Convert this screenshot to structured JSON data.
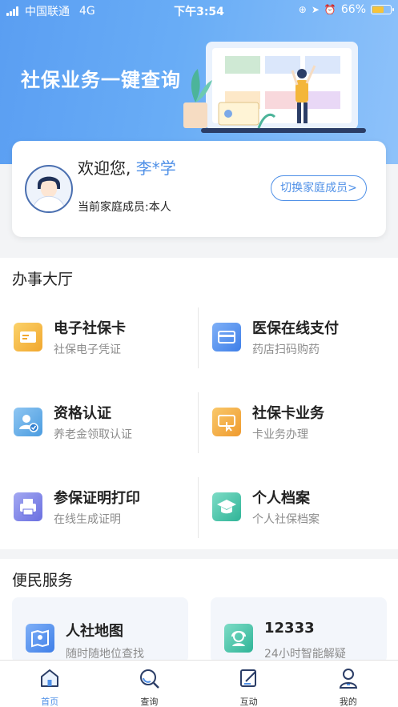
{
  "status_bar": {
    "carrier": "中国联通",
    "network": "4G",
    "time": "下午3:54",
    "battery": "66%"
  },
  "hero": {
    "title": "社保业务一键查询"
  },
  "user_card": {
    "greeting": "欢迎您,",
    "user_name": "李*学",
    "family_member": "当前家庭成员:本人",
    "switch_label": "切换家庭成员>"
  },
  "hall": {
    "title": "办事大厅",
    "items": [
      {
        "title": "电子社保卡",
        "subtitle": "社保电子凭证",
        "icon": "e-card-icon",
        "color": "#f4b63a"
      },
      {
        "title": "医保在线支付",
        "subtitle": "药店扫码购药",
        "icon": "payment-card-icon",
        "color": "#4f8ff0"
      },
      {
        "title": "资格认证",
        "subtitle": "养老金领取认证",
        "icon": "user-verify-icon",
        "color": "#5aa8e8"
      },
      {
        "title": "社保卡业务",
        "subtitle": "卡业务办理",
        "icon": "card-service-icon",
        "color": "#f3a63c"
      },
      {
        "title": "参保证明打印",
        "subtitle": "在线生成证明",
        "icon": "printer-icon",
        "color": "#7e83e8"
      },
      {
        "title": "个人档案",
        "subtitle": "个人社保档案",
        "icon": "graduation-cap-icon",
        "color": "#3fc3a8"
      }
    ]
  },
  "services": {
    "title": "便民服务",
    "items": [
      {
        "title": "人社地图",
        "subtitle": "随时随地位查找",
        "icon": "map-icon",
        "color": "#4f8ff0"
      },
      {
        "title": "12333",
        "subtitle": "24小时智能解疑",
        "icon": "customer-service-icon",
        "color": "#3fc3a8"
      }
    ]
  },
  "tabbar": {
    "tabs": [
      {
        "label": "首页",
        "icon": "home-icon",
        "active": true
      },
      {
        "label": "查询",
        "icon": "search-icon",
        "active": false
      },
      {
        "label": "互动",
        "icon": "edit-icon",
        "active": false
      },
      {
        "label": "我的",
        "icon": "profile-icon",
        "active": false
      }
    ],
    "active_color": "#4f90e7"
  }
}
